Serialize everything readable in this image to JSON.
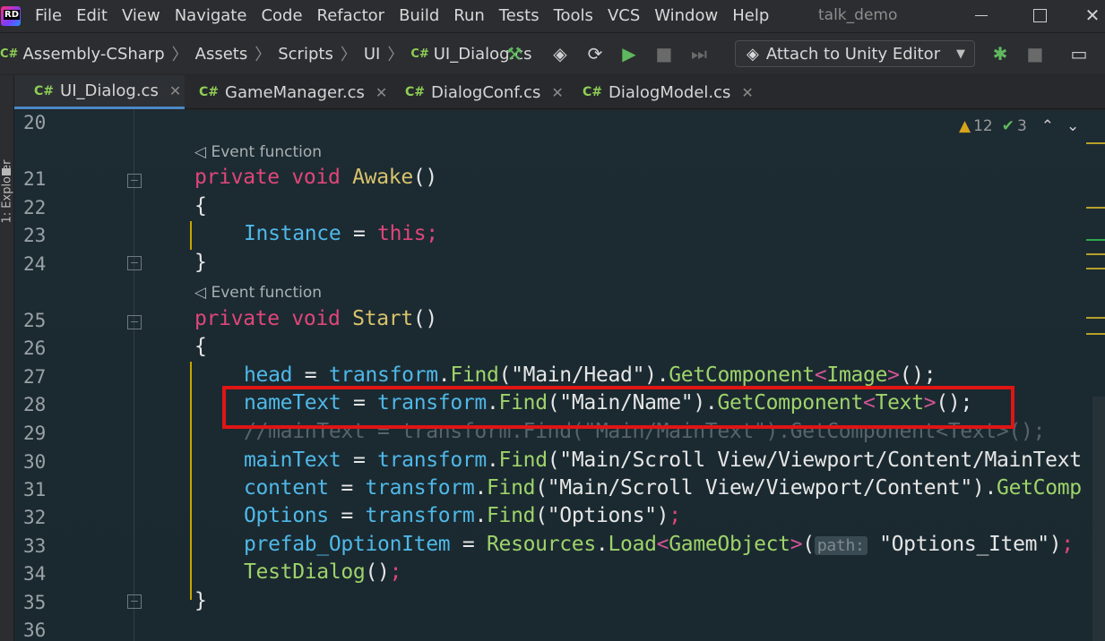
{
  "menubar": {
    "items": [
      "File",
      "Edit",
      "View",
      "Navigate",
      "Code",
      "Refactor",
      "Build",
      "Run",
      "Tests",
      "Tools",
      "VCS",
      "Window",
      "Help"
    ],
    "window_title": "talk_demo"
  },
  "navbar": {
    "breadcrumb": [
      "Assembly-CSharp",
      "Assets",
      "Scripts",
      "UI",
      "UI_Dialog.cs"
    ],
    "cs_tag": "C#",
    "attach_label": "Attach to Unity Editor"
  },
  "tabs": [
    {
      "label": "UI_Dialog.cs",
      "active": true
    },
    {
      "label": "GameManager.cs",
      "active": false
    },
    {
      "label": "DialogConf.cs",
      "active": false
    },
    {
      "label": "DialogModel.cs",
      "active": false
    }
  ],
  "side": {
    "explorer_label": "1: Explorer"
  },
  "inspection": {
    "warnings": "12",
    "ok": "3"
  },
  "editor": {
    "hint": "Event function",
    "line_numbers": [
      "20",
      "21",
      "22",
      "23",
      "24",
      "25",
      "26",
      "27",
      "28",
      "29",
      "30",
      "31",
      "32",
      "33",
      "34",
      "35",
      "36"
    ],
    "lines": {
      "l21_kw": "private void ",
      "l21_fn": "Awake",
      "l21_rest": "()",
      "l22": "{",
      "l23_fld": "Instance",
      "l23_op": " = ",
      "l23_kw": "this;",
      "l24": "}",
      "l25_kw": "private void ",
      "l25_fn": "Start",
      "l25_rest": "()",
      "l26": "{",
      "l27_head": "head",
      "l27_a": " = ",
      "l27_tr": "transform",
      "l27_b": ".",
      "l27_find": "Find",
      "l27_str": "(\"Main/Head\")",
      "l27_c": ".",
      "l27_gc": "GetComponent",
      "l27_lt": "<",
      "l27_t": "Image",
      "l27_gt": ">",
      "l27_end": "();",
      "l28_name": "nameText",
      "l28_a": " = ",
      "l28_tr": "transform",
      "l28_b": ".",
      "l28_find": "Find",
      "l28_str": "(\"Main/Name\")",
      "l28_c": ".",
      "l28_gc": "GetComponent",
      "l28_lt": "<",
      "l28_t": "Text",
      "l28_gt": ">",
      "l28_end": "();",
      "l29_comment": "//mainText = transform.Find(\"Main/MainText\").GetComponent<Text>();",
      "l30_f": "mainText",
      "l30_a": " = ",
      "l30_tr": "transform",
      "l30_b": ".",
      "l30_find": "Find",
      "l30_str": "(\"Main/Scroll View/Viewport/Content/MainText",
      "l31_f": "content",
      "l31_a": " = ",
      "l31_tr": "transform",
      "l31_b": ".",
      "l31_find": "Find",
      "l31_str": "(\"Main/Scroll View/Viewport/Content\")",
      "l31_c": ".",
      "l31_gc": "GetComp",
      "l32_f": "Options",
      "l32_a": " = ",
      "l32_tr": "transform",
      "l32_b": ".",
      "l32_find": "Find",
      "l32_str": "(\"Options\")",
      "l32_end": ";",
      "l33_f": "prefab_OptionItem",
      "l33_a": " = ",
      "l33_res": "Resources",
      "l33_b": ".",
      "l33_load": "Load",
      "l33_lt": "<",
      "l33_t": "GameObject",
      "l33_gt": ">",
      "l33_p": "(",
      "l33_param": "path:",
      "l33_str": " \"Options_Item\")",
      "l33_end": ";",
      "l34_fn": "TestDialog",
      "l34_rest": "()",
      "l34_end": ";",
      "l35": "}"
    }
  },
  "colors": {
    "keyword": "#e0467a",
    "field": "#4fb8e8",
    "method": "#9fd36a",
    "highlight_box": "#e01515",
    "warning": "#d6a41b",
    "ok": "#5fb85f"
  }
}
